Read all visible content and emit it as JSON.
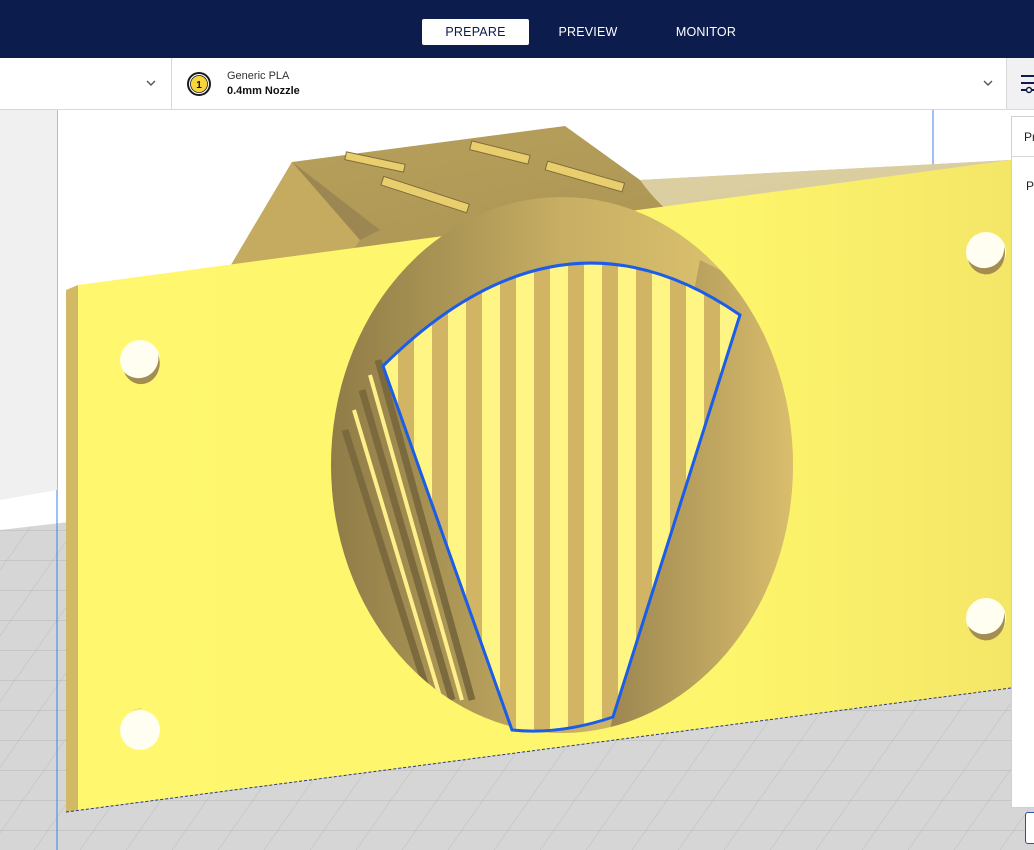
{
  "header": {
    "stages": [
      {
        "label": "PREPARE",
        "active": true
      },
      {
        "label": "PREVIEW",
        "active": false
      },
      {
        "label": "MONITOR",
        "active": false
      }
    ]
  },
  "toolbar": {
    "printer": {
      "icon": "chevron-down-icon"
    },
    "extruder": {
      "number": "1",
      "material": "Generic PLA",
      "nozzle": "0.4mm Nozzle",
      "icon": "chevron-down-icon"
    },
    "settings_icon": "sliders-icon"
  },
  "side_panel": {
    "header": "Pr",
    "body": "P"
  },
  "colors": {
    "header_bg": "#0c1c4d",
    "model_yellow": "#fdf56b",
    "model_shadow": "#c9b15e",
    "selection_outline": "#1c5de8",
    "build_plate": "#d6d6d6",
    "axis_line": "#3e7ff0"
  }
}
